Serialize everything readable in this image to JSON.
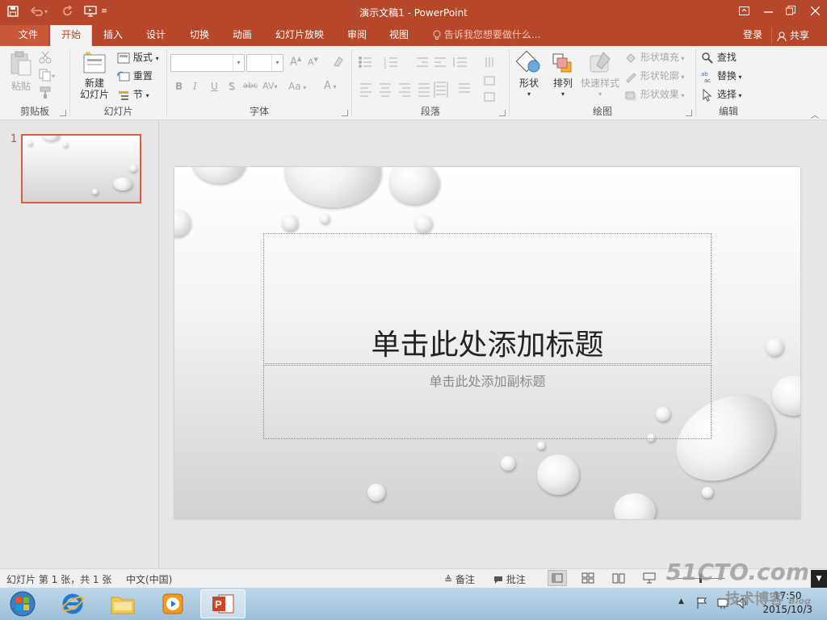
{
  "window": {
    "title": "演示文稿1 - PowerPoint",
    "quick_access": [
      "save-icon",
      "undo-icon",
      "redo-icon",
      "present-icon",
      "customize-icon"
    ]
  },
  "tabs": [
    {
      "label": "文件",
      "name": "tab-file"
    },
    {
      "label": "开始",
      "name": "tab-home",
      "active": true
    },
    {
      "label": "插入",
      "name": "tab-insert"
    },
    {
      "label": "设计",
      "name": "tab-design"
    },
    {
      "label": "切换",
      "name": "tab-transitions"
    },
    {
      "label": "动画",
      "name": "tab-animations"
    },
    {
      "label": "幻灯片放映",
      "name": "tab-slideshow"
    },
    {
      "label": "审阅",
      "name": "tab-review"
    },
    {
      "label": "视图",
      "name": "tab-view"
    }
  ],
  "tell_me": "告诉我您想要做什么...",
  "account": {
    "login": "登录",
    "share": "共享"
  },
  "ribbon": {
    "clipboard": {
      "label": "剪贴板",
      "paste": "粘贴"
    },
    "slides": {
      "label": "幻灯片",
      "new_slide_line1": "新建",
      "new_slide_line2": "幻灯片",
      "layout": "版式",
      "reset": "重置",
      "section": "节"
    },
    "font": {
      "label": "字体",
      "font_name": "",
      "font_size": "",
      "bold": "B",
      "italic": "I",
      "underline": "U",
      "shadow": "S",
      "strike": "abc",
      "spacing": "AV",
      "case": "Aa",
      "color": "A"
    },
    "paragraph": {
      "label": "段落"
    },
    "drawing": {
      "label": "绘图",
      "shapes": "形状",
      "arrange": "排列",
      "quick_styles": "快速样式",
      "fill": "形状填充",
      "outline": "形状轮廓",
      "effects": "形状效果"
    },
    "editing": {
      "label": "编辑",
      "find": "查找",
      "replace": "替换",
      "select": "选择"
    }
  },
  "thumbnail": {
    "number": "1"
  },
  "slide": {
    "title_placeholder": "单击此处添加标题",
    "subtitle_placeholder": "单击此处添加副标题"
  },
  "status": {
    "slide_info": "幻灯片 第 1 张，共 1 张",
    "language": "中文(中国)",
    "notes": "备注",
    "comments": "批注",
    "zoom_minus": "-"
  },
  "taskbar": {
    "apps": [
      "start-orb",
      "internet-explorer",
      "file-explorer",
      "media-player",
      "powerpoint"
    ],
    "time": "17:50",
    "date": "2015/10/3"
  },
  "watermark": {
    "line1": "51CTO.com",
    "line2": "技术博客",
    "tag": "Blog"
  },
  "colors": {
    "accent": "#b7472a",
    "tab_active_text": "#b7472a",
    "thumb_border": "#d75f3f"
  }
}
